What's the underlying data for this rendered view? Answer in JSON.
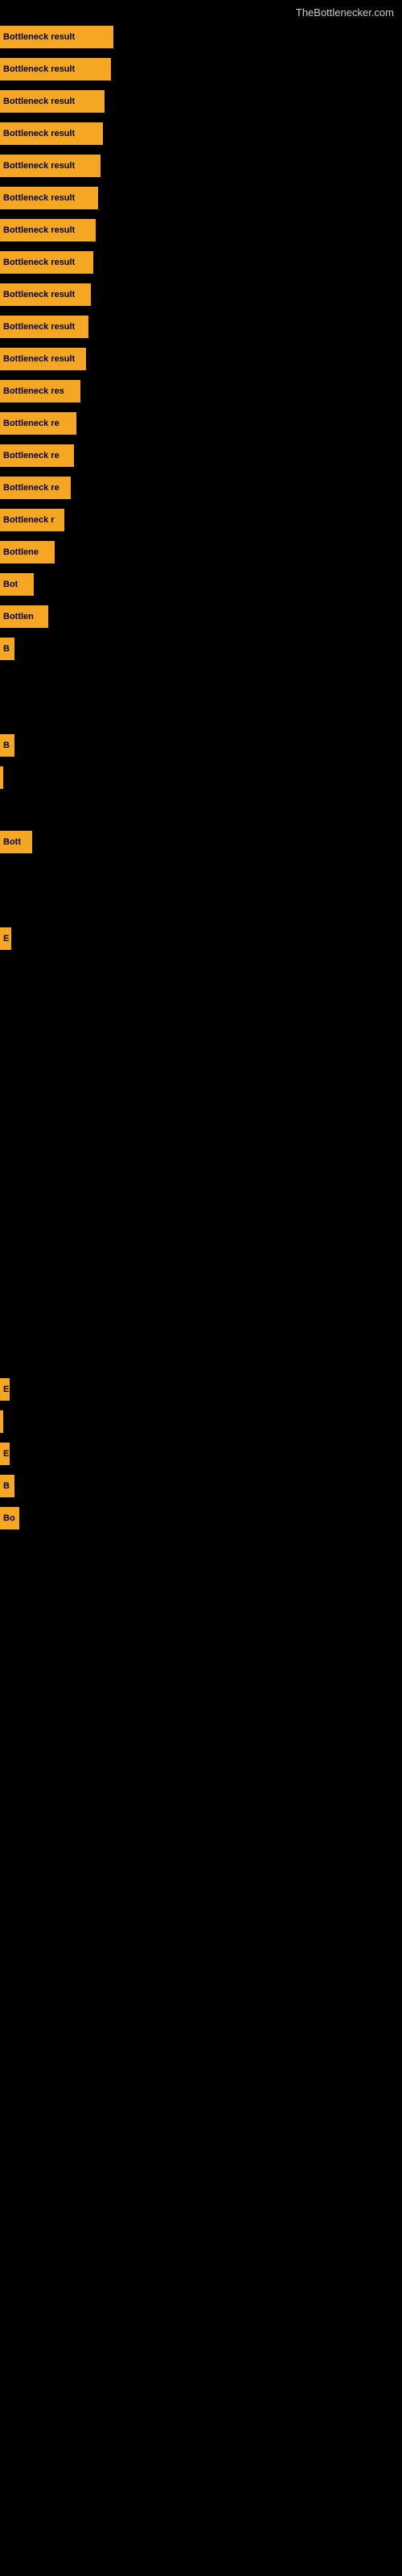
{
  "header": {
    "title": "TheBottlenecker.com"
  },
  "bars": [
    {
      "label": "Bottleneck result",
      "width": 141
    },
    {
      "label": "Bottleneck result",
      "width": 138
    },
    {
      "label": "Bottleneck result",
      "width": 130
    },
    {
      "label": "Bottleneck result",
      "width": 128
    },
    {
      "label": "Bottleneck result",
      "width": 125
    },
    {
      "label": "Bottleneck result",
      "width": 122
    },
    {
      "label": "Bottleneck result",
      "width": 119
    },
    {
      "label": "Bottleneck result",
      "width": 116
    },
    {
      "label": "Bottleneck result",
      "width": 113
    },
    {
      "label": "Bottleneck result",
      "width": 110
    },
    {
      "label": "Bottleneck result",
      "width": 107
    },
    {
      "label": "Bottleneck res",
      "width": 100
    },
    {
      "label": "Bottleneck re",
      "width": 95
    },
    {
      "label": "Bottleneck re",
      "width": 92
    },
    {
      "label": "Bottleneck re",
      "width": 88
    },
    {
      "label": "Bottleneck r",
      "width": 80
    },
    {
      "label": "Bottlene",
      "width": 68
    },
    {
      "label": "Bot",
      "width": 42
    },
    {
      "label": "Bottlen",
      "width": 60
    },
    {
      "label": "B",
      "width": 18
    },
    {
      "label": "",
      "width": 0
    },
    {
      "label": "",
      "width": 0
    },
    {
      "label": "B",
      "width": 18
    },
    {
      "label": "",
      "width": 4
    },
    {
      "label": "",
      "width": 0
    },
    {
      "label": "Bott",
      "width": 40
    },
    {
      "label": "",
      "width": 0
    },
    {
      "label": "",
      "width": 0
    },
    {
      "label": "E",
      "width": 14
    },
    {
      "label": "",
      "width": 0
    },
    {
      "label": "",
      "width": 0
    },
    {
      "label": "",
      "width": 0
    },
    {
      "label": "",
      "width": 0
    },
    {
      "label": "",
      "width": 0
    },
    {
      "label": "",
      "width": 0
    },
    {
      "label": "",
      "width": 0
    },
    {
      "label": "",
      "width": 0
    },
    {
      "label": "",
      "width": 0
    },
    {
      "label": "",
      "width": 0
    },
    {
      "label": "",
      "width": 0
    },
    {
      "label": "",
      "width": 0
    },
    {
      "label": "",
      "width": 0
    },
    {
      "label": "E",
      "width": 12
    },
    {
      "label": "",
      "width": 4
    },
    {
      "label": "E",
      "width": 12
    },
    {
      "label": "B",
      "width": 18
    },
    {
      "label": "Bo",
      "width": 24
    }
  ]
}
